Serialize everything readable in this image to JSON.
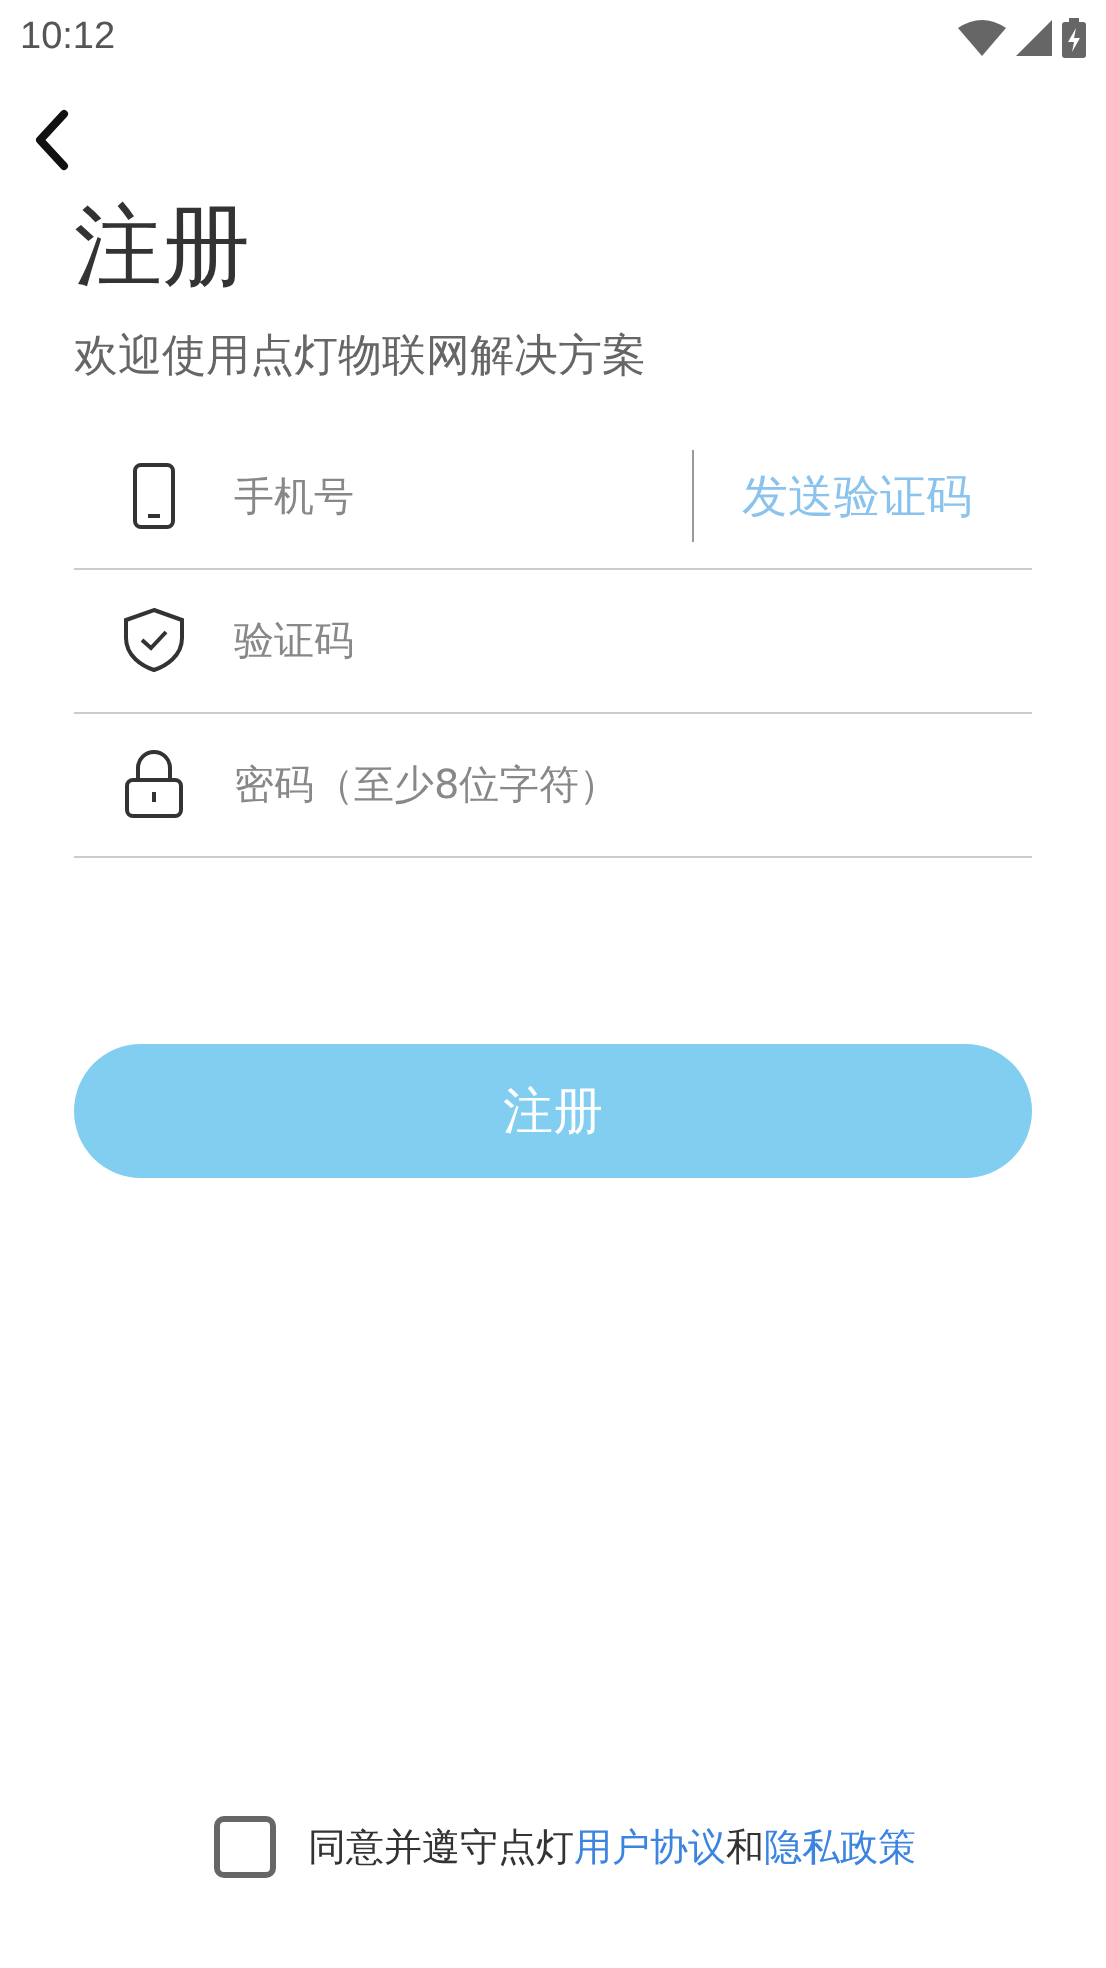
{
  "status_bar": {
    "time": "10:12"
  },
  "title": "注册",
  "subtitle": "欢迎使用点灯物联网解决方案",
  "fields": [
    {
      "kind": "phone",
      "placeholder": "手机号",
      "action": "发送验证码"
    },
    {
      "kind": "code",
      "placeholder": "验证码"
    },
    {
      "kind": "password",
      "placeholder": "密码（至少8位字符）"
    }
  ],
  "submit": {
    "label": "注册",
    "disabled": true
  },
  "agreement": {
    "checked": false,
    "parts": [
      {
        "kind": "text",
        "text": "同意并遵守点灯"
      },
      {
        "kind": "link",
        "text": "用户协议"
      },
      {
        "kind": "text",
        "text": "和"
      },
      {
        "kind": "link",
        "text": "隐私政策"
      }
    ]
  }
}
